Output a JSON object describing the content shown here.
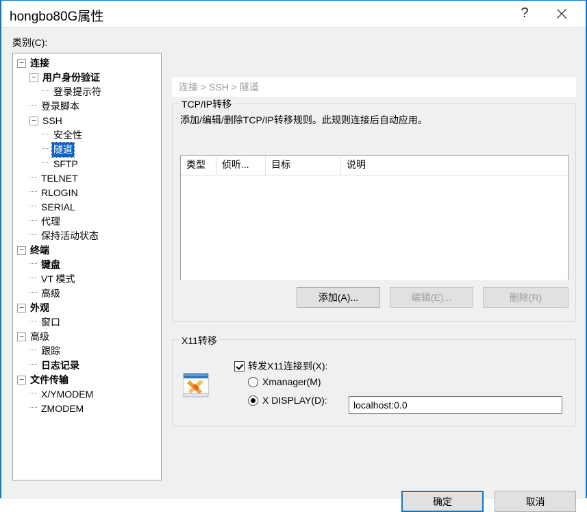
{
  "window": {
    "title": "hongbo80G属性",
    "help_icon": "question-mark-icon",
    "close_icon": "close-icon"
  },
  "sidebar": {
    "label": "类别(C):",
    "selected": "隧道",
    "items": [
      {
        "label": "连接",
        "level": 0,
        "bold": true,
        "expander": "minus"
      },
      {
        "label": "用户身份验证",
        "level": 1,
        "bold": true,
        "expander": "minus"
      },
      {
        "label": "登录提示符",
        "level": 2,
        "bold": false,
        "expander": "leaf"
      },
      {
        "label": "登录脚本",
        "level": 1,
        "bold": false,
        "expander": "leaf"
      },
      {
        "label": "SSH",
        "level": 1,
        "bold": false,
        "expander": "minus"
      },
      {
        "label": "安全性",
        "level": 2,
        "bold": false,
        "expander": "leaf"
      },
      {
        "label": "隧道",
        "level": 2,
        "bold": false,
        "expander": "leaf",
        "selected": true
      },
      {
        "label": "SFTP",
        "level": 2,
        "bold": false,
        "expander": "leaf"
      },
      {
        "label": "TELNET",
        "level": 1,
        "bold": false,
        "expander": "leaf"
      },
      {
        "label": "RLOGIN",
        "level": 1,
        "bold": false,
        "expander": "leaf"
      },
      {
        "label": "SERIAL",
        "level": 1,
        "bold": false,
        "expander": "leaf"
      },
      {
        "label": "代理",
        "level": 1,
        "bold": false,
        "expander": "leaf"
      },
      {
        "label": "保持活动状态",
        "level": 1,
        "bold": false,
        "expander": "leaf"
      },
      {
        "label": "终端",
        "level": 0,
        "bold": true,
        "expander": "minus"
      },
      {
        "label": "键盘",
        "level": 1,
        "bold": true,
        "expander": "leaf"
      },
      {
        "label": "VT 模式",
        "level": 1,
        "bold": false,
        "expander": "leaf"
      },
      {
        "label": "高级",
        "level": 1,
        "bold": false,
        "expander": "leaf"
      },
      {
        "label": "外观",
        "level": 0,
        "bold": true,
        "expander": "minus"
      },
      {
        "label": "窗口",
        "level": 1,
        "bold": false,
        "expander": "leaf"
      },
      {
        "label": "高级",
        "level": 0,
        "bold": false,
        "expander": "minus"
      },
      {
        "label": "跟踪",
        "level": 1,
        "bold": false,
        "expander": "leaf"
      },
      {
        "label": "日志记录",
        "level": 1,
        "bold": true,
        "expander": "leaf"
      },
      {
        "label": "文件传输",
        "level": 0,
        "bold": true,
        "expander": "minus"
      },
      {
        "label": "X/YMODEM",
        "level": 1,
        "bold": false,
        "expander": "leaf"
      },
      {
        "label": "ZMODEM",
        "level": 1,
        "bold": false,
        "expander": "leaf"
      }
    ]
  },
  "main": {
    "breadcrumb": "连接 > SSH > 隧道",
    "tcp_group": {
      "title": "TCP/IP转移",
      "description": "添加/编辑/删除TCP/IP转移规则。此规则连接后自动应用。",
      "columns": [
        "类型",
        "侦听...",
        "目标",
        "说明"
      ],
      "rows": [],
      "buttons": {
        "add": "添加(A)...",
        "edit": "编辑(E)...",
        "delete": "删除(R)"
      }
    },
    "x11_group": {
      "title": "X11转移",
      "icon": "xmanager-icon",
      "forward_checkbox": "转发X11连接到(X):",
      "forward_checked": true,
      "option_xmanager": "Xmanager(M)",
      "option_xdisplay": "X DISPLAY(D):",
      "selected_option": "xdisplay",
      "display_value": "localhost:0.0"
    }
  },
  "footer": {
    "ok": "确定",
    "cancel": "取消"
  },
  "colors": {
    "accent": "#0078d7",
    "selection": "#0a64c8",
    "dialog_bg": "#f0f0f0",
    "disabled_text": "#9d9d9d"
  }
}
